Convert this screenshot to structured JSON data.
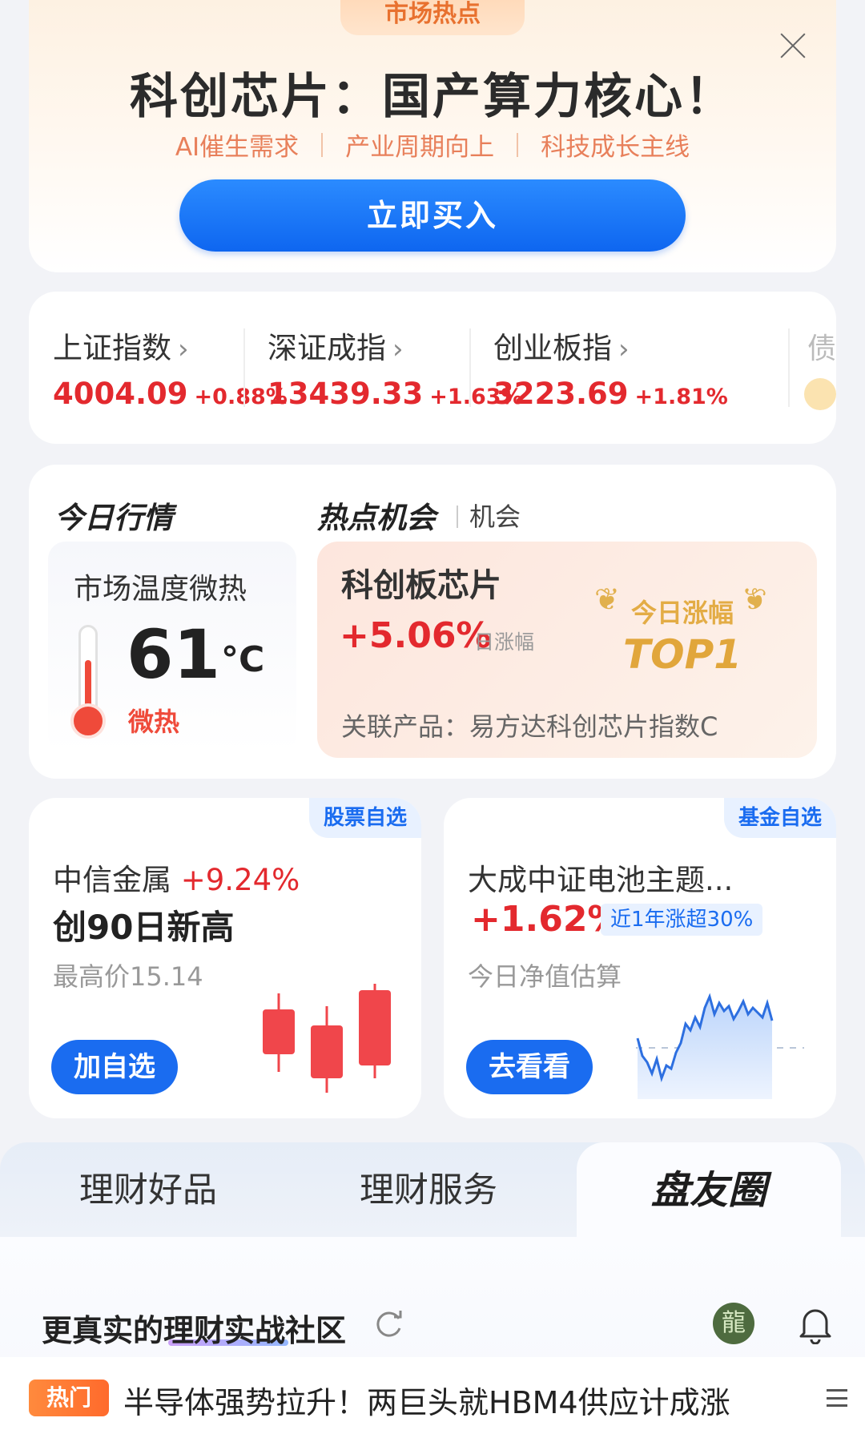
{
  "banner": {
    "tag": "市场热点",
    "title": "科创芯片：国产算力核心！",
    "subs": [
      "AI催生需求",
      "产业周期向上",
      "科技成长主线"
    ],
    "buy_button": "立即买入"
  },
  "indices": [
    {
      "name": "上证指数",
      "chevron": "›",
      "value": "4004.09",
      "change": "+0.88%"
    },
    {
      "name": "深证成指",
      "chevron": "›",
      "value": "13439.33",
      "change": "+1.63%"
    },
    {
      "name": "创业板指",
      "chevron": "›",
      "value": "3223.69",
      "change": "+1.81%"
    }
  ],
  "indices_more": "债",
  "market": {
    "title": "今日行情",
    "hot_title": "热点机会",
    "hot_sub": "机会",
    "temp_label": "市场温度微热",
    "temp_value": "61",
    "temp_unit": "°C",
    "temp_state": "微热",
    "hot_name": "科创板芯片",
    "hot_rise": "+5.06%",
    "hot_rise_label": "日涨幅",
    "badge_line1": "今日涨幅",
    "badge_line2": "TOP1",
    "related": "关联产品：易方达科创芯片指数C"
  },
  "stock_card": {
    "tag": "股票自选",
    "name": "中信金属",
    "change": "+9.24%",
    "headline": "创90日新高",
    "sub": "最高价15.14",
    "button": "加自选"
  },
  "fund_card": {
    "tag": "基金自选",
    "name": "大成中证电池主题...",
    "change": "+1.62%",
    "badge": "近1年涨超30%",
    "sub": "今日净值估算",
    "button": "去看看"
  },
  "tabs": [
    "理财好品",
    "理财服务",
    "盘友圈"
  ],
  "community": {
    "title": "更真实的理财实战社区",
    "avatar_text": "龍"
  },
  "news": {
    "tag": "热门",
    "text": "半导体强势拉升！两巨头就HBM4供应计成涨"
  },
  "colors": {
    "up": "#e3292e",
    "accent": "#1a6cf0",
    "warm": "#e8805b"
  },
  "icons": [
    "close-icon",
    "chevron-right-icon",
    "thermometer-icon",
    "refresh-icon",
    "bell-icon",
    "menu-icon"
  ]
}
